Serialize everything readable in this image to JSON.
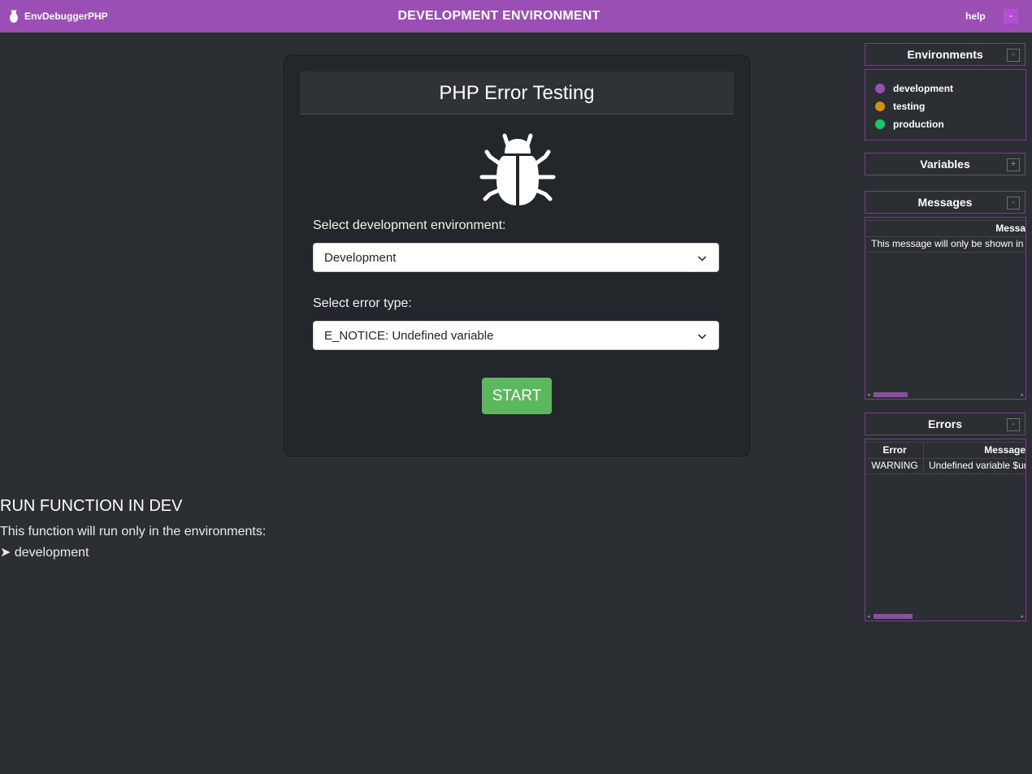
{
  "topbar": {
    "brand": "EnvDebuggerPHP",
    "title": "DEVELOPMENT ENVIRONMENT",
    "help": "help",
    "collapse": "-"
  },
  "card": {
    "title": "PHP Error Testing",
    "env_label": "Select development environment:",
    "env_value": "Development",
    "error_label": "Select error type:",
    "error_value": "E_NOTICE: Undefined variable",
    "start": "START"
  },
  "run": {
    "title": "RUN FUNCTION IN DEV",
    "desc": "This function will run only in the environments:",
    "env": "➤ development"
  },
  "panels": {
    "environments": {
      "title": "Environments",
      "toggle": "-",
      "items": [
        {
          "label": "development",
          "color": "#9b4fb5"
        },
        {
          "label": "testing",
          "color": "#d4900f"
        },
        {
          "label": "production",
          "color": "#16c86b"
        }
      ]
    },
    "variables": {
      "title": "Variables",
      "toggle": "+"
    },
    "messages": {
      "title": "Messages",
      "toggle": "-",
      "header": "Messa",
      "row": "This message will only be shown in"
    },
    "errors": {
      "title": "Errors",
      "toggle": "-",
      "col_error": "Error",
      "col_message": "Message",
      "row_error": "WARNING",
      "row_message": "Undefined variable $ur"
    }
  }
}
